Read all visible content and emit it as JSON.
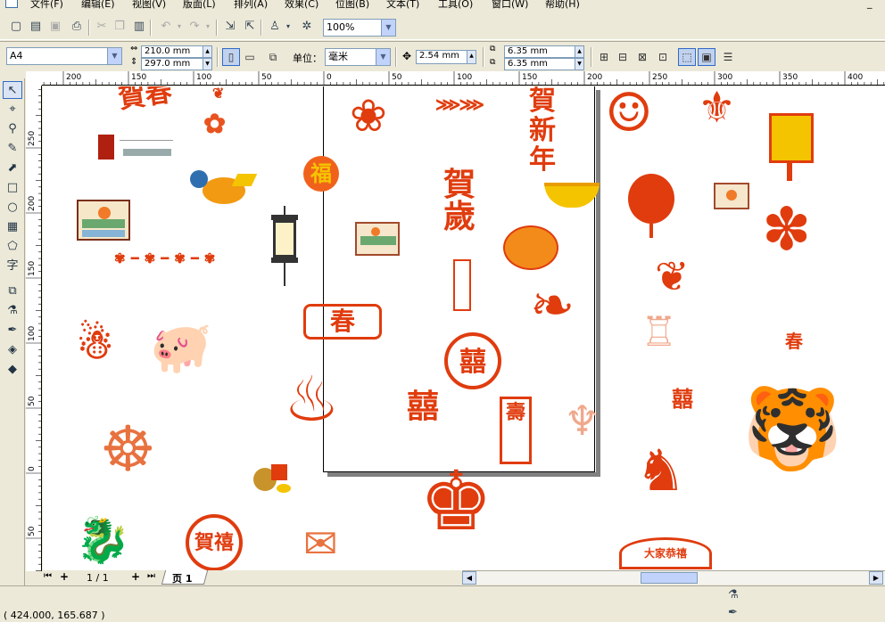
{
  "menu": {
    "items": [
      "文件(F)",
      "编辑(E)",
      "视图(V)",
      "版面(L)",
      "排列(A)",
      "效果(C)",
      "位图(B)",
      "文本(T)",
      "工具(O)",
      "窗口(W)",
      "帮助(H)"
    ],
    "minimize": "_"
  },
  "toolbar": {
    "zoom": "100%"
  },
  "propertybar": {
    "paper": "A4",
    "width": "210.0 mm",
    "height": "297.0 mm",
    "units_label": "单位：",
    "units": "毫米",
    "nudge": "2.54 mm",
    "dup_x": "6.35 mm",
    "dup_y": "6.35 mm"
  },
  "rulers": {
    "h_ticks": [
      "200",
      "150",
      "100",
      "50",
      "0",
      "50",
      "100",
      "150",
      "200",
      "250",
      "300",
      "350",
      "400"
    ],
    "v_ticks": [
      "250",
      "200",
      "150",
      "100",
      "50",
      "0",
      "50"
    ]
  },
  "artwork": {
    "he_chun": "賀春",
    "fu": "福",
    "he_sui": "賀歲",
    "chun": "春",
    "shuang_xi": "囍",
    "shou": "壽",
    "he_xi": "賀禧",
    "chun_2": "春",
    "da_jia": "大家恭禧",
    "he_xin": "賀新年"
  },
  "pagenav": {
    "counter": "1 / 1",
    "page_tab": "页 1"
  },
  "statusbar": {
    "coordinates": "( 424.000, 165.687 )"
  },
  "colors": {
    "papercut_red": "#e03c0e",
    "gold": "#f5c400",
    "selection_blue": "#316ac5"
  }
}
